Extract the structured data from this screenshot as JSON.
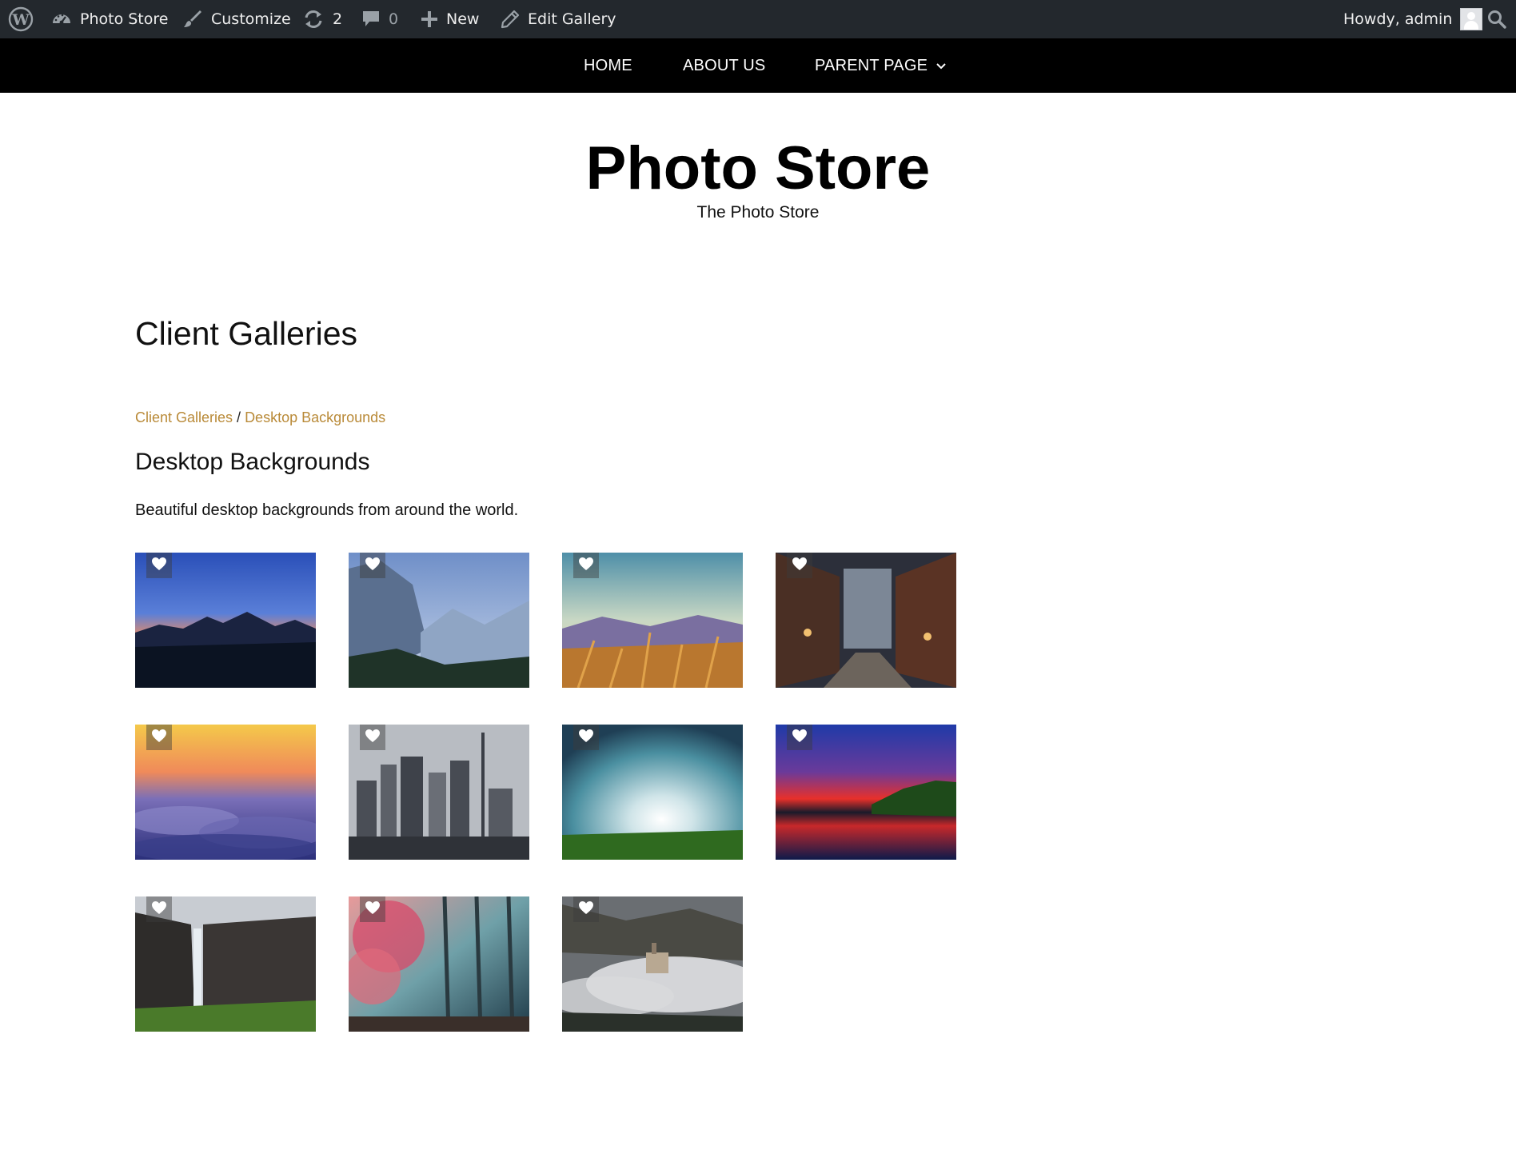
{
  "adminbar": {
    "wp_logo_icon": "wordpress-icon",
    "site_label": "Photo Store",
    "customize_label": "Customize",
    "updates_count": "2",
    "comments_count": "0",
    "new_label": "New",
    "edit_label": "Edit Gallery",
    "howdy_label": "Howdy, admin"
  },
  "nav": {
    "items": [
      {
        "label": "HOME"
      },
      {
        "label": "ABOUT US"
      },
      {
        "label": "PARENT PAGE"
      }
    ]
  },
  "header": {
    "site_title": "Photo Store",
    "tagline": "The Photo Store"
  },
  "main": {
    "page_title": "Client Galleries",
    "breadcrumb": {
      "parent": "Client Galleries",
      "separator": " / ",
      "current": "Desktop Backgrounds"
    },
    "gallery_title": "Desktop Backgrounds",
    "gallery_description": "Beautiful desktop backgrounds from around the world."
  },
  "colors": {
    "adminbar_bg": "#23282d",
    "nav_bg": "#000000",
    "link_accent": "#b98a38"
  },
  "gallery": {
    "thumbnails": [
      {
        "scene": "mountain-sunset"
      },
      {
        "scene": "granite-valley"
      },
      {
        "scene": "wheat-field"
      },
      {
        "scene": "city-street"
      },
      {
        "scene": "sunset-clouds"
      },
      {
        "scene": "city-skyline"
      },
      {
        "scene": "cloudy-field"
      },
      {
        "scene": "red-lake"
      },
      {
        "scene": "waterfall-cliff"
      },
      {
        "scene": "misty-forest"
      },
      {
        "scene": "fog-castle"
      }
    ]
  }
}
